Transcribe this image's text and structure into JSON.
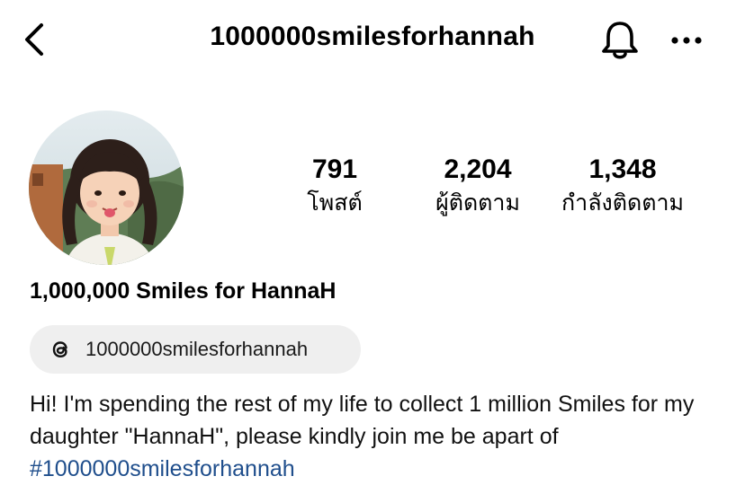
{
  "header": {
    "username": "1000000smilesforhannah",
    "back_icon": "chevron-left-icon",
    "bell_icon": "bell-icon",
    "more_icon": "more-horizontal-icon"
  },
  "profile": {
    "avatar_icon": "profile-photo",
    "stats": [
      {
        "value": "791",
        "label": "โพสต์"
      },
      {
        "value": "2,204",
        "label": "ผู้ติดตาม"
      },
      {
        "value": "1,348",
        "label": "กำลังติดตาม"
      }
    ],
    "display_name": "1,000,000 Smiles for HannaH",
    "threads": {
      "icon": "threads-icon",
      "label": "1000000smilesforhannah"
    },
    "bio": {
      "text": "Hi! I'm spending the rest of my life to collect 1 million Smiles for my daughter \"HannaH\", please kindly join me be apart of ",
      "hashtag": "#1000000smilesforhannah"
    }
  },
  "colors": {
    "hashtag": "#1f4e8c",
    "badge_bg": "#efefef",
    "text": "#000000"
  }
}
